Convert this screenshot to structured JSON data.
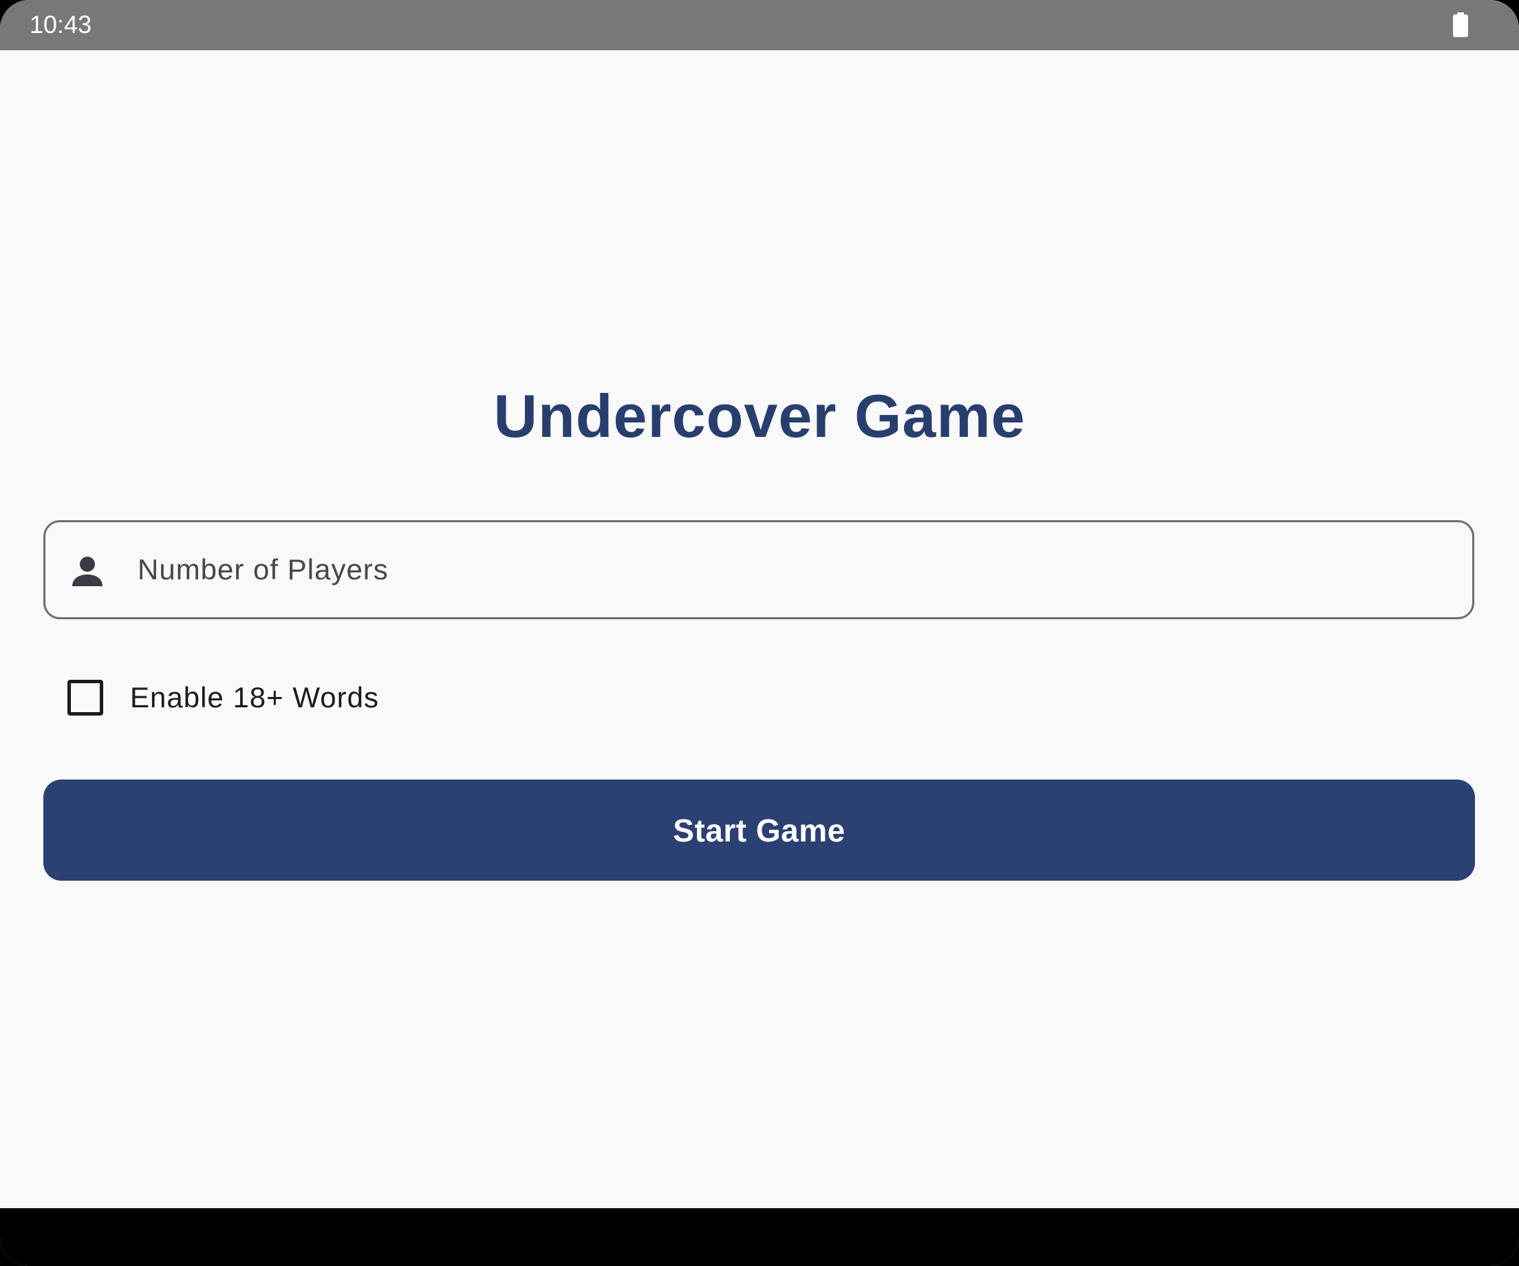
{
  "status_bar": {
    "time": "10:43",
    "battery_icon": "battery-full-icon"
  },
  "main": {
    "title": "Undercover Game",
    "players_input": {
      "icon": "person-icon",
      "placeholder": "Number of Players",
      "value": ""
    },
    "adult_words_checkbox": {
      "label": "Enable 18+ Words",
      "checked": false
    },
    "start_button_label": "Start Game"
  },
  "colors": {
    "primary": "#2b4073",
    "title": "#283e6e",
    "background": "#f9f9f9",
    "status_bar": "#787878"
  }
}
